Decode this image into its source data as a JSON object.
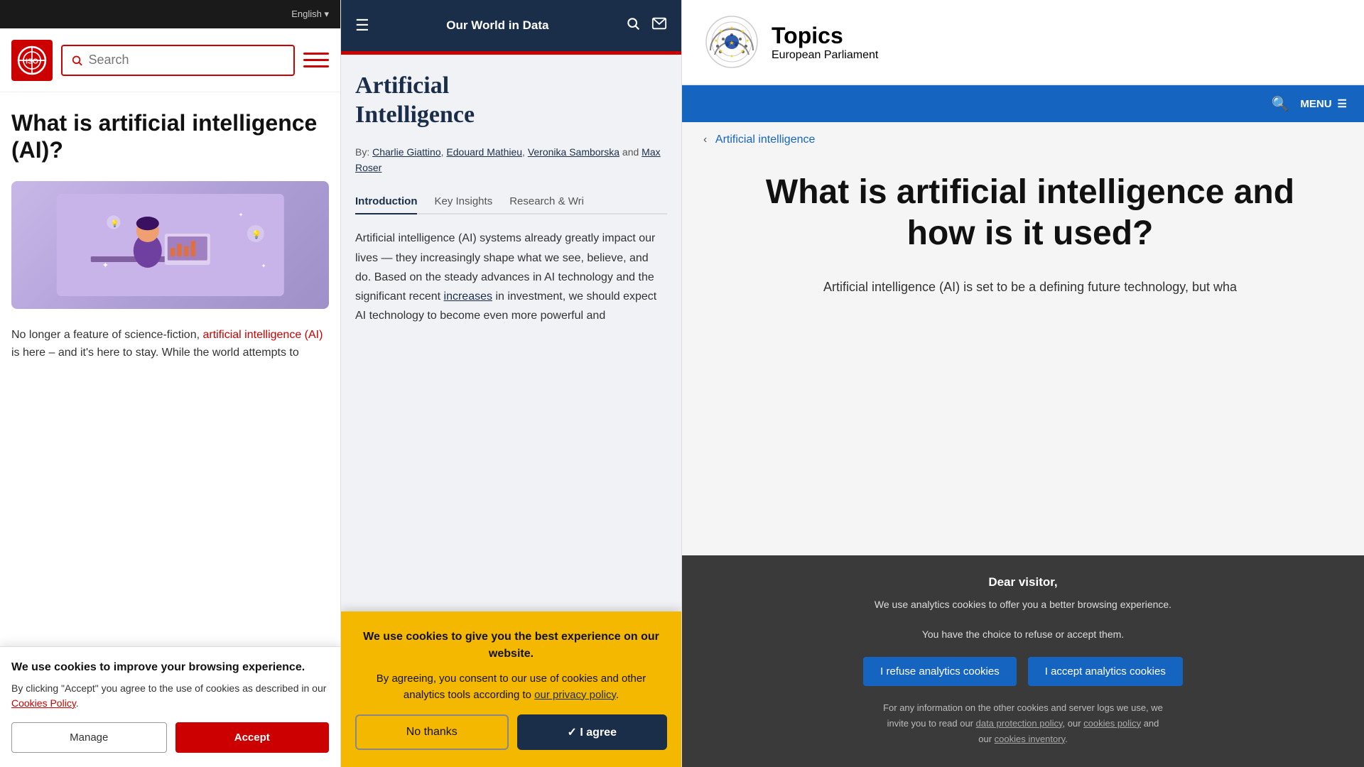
{
  "iso": {
    "topbar": {
      "language": "English ▾"
    },
    "logo": "ISO",
    "search_placeholder": "Search",
    "article_title": "What is artificial intelligence (AI)?",
    "body_text_start": "No longer a feature of science-fiction, ",
    "body_text_link": "artificial intelligence (AI)",
    "body_text_end": " is here – and it's here to stay. While the world attempts to",
    "cookie": {
      "title": "We use cookies to improve your browsing experience.",
      "description": "By clicking \"Accept\" you agree to the use of cookies as described in our ",
      "policy_link": "Cookies Policy",
      "policy_end": ".",
      "btn_manage": "Manage",
      "btn_accept": "Accept"
    }
  },
  "owid": {
    "header_title": "Our World\nin Data",
    "page_title": "Artificial\nIntelligence",
    "authors_prefix": "By: ",
    "authors": [
      {
        "name": "Charlie Giattino",
        "url": "#"
      },
      {
        "name": "Edouard Mathieu",
        "url": "#"
      },
      {
        "name": "Veronika Samborska",
        "url": "#"
      },
      {
        "name": "Max Roser",
        "url": "#"
      }
    ],
    "tabs": [
      {
        "label": "Introduction",
        "active": true
      },
      {
        "label": "Key Insights",
        "active": false
      },
      {
        "label": "Research & Wri",
        "active": false
      }
    ],
    "body_text": "Artificial intelligence (AI) systems already greatly impact our lives — they increasingly shape what we see, believe, and do. Based on the steady advances in AI technology and the significant recent ",
    "body_text_link": "increases",
    "body_text_end": " in investment, we should expect AI technology to become even more powerful and",
    "cookie": {
      "line1": "We use cookies to give you the best experience on our website.",
      "line2": "By agreeing, you consent to our use of cookies and other analytics tools according to ",
      "policy_link": "our privacy policy",
      "line3": ".",
      "btn_no": "No thanks",
      "btn_agree": "✓  I agree"
    }
  },
  "ep": {
    "logo_alt": "European Parliament Logo",
    "header_title": "Topics",
    "header_subtitle": "European Parliament",
    "nav_menu": "MENU",
    "breadcrumb": "Artificial intelligence",
    "article_title": "What is artificial intelligence and how is it used?",
    "body_text": "Artificial intelligence (AI) is set to be a defining future technology, but wha",
    "cookie": {
      "dear": "Dear visitor,",
      "desc1": "We use analytics cookies to offer you a better browsing experience.",
      "desc2": "You have the choice to refuse or accept them.",
      "btn_refuse": "I refuse analytics cookies",
      "btn_accept": "I accept analytics cookies",
      "footer1": "For any information on the other cookies and server logs we use, we",
      "footer2": "invite you to read our ",
      "footer_link1": "data protection policy",
      "footer3": ", our ",
      "footer_link2": "cookies policy",
      "footer4": " and",
      "footer5": "our ",
      "footer_link3": "cookies inventory",
      "footer6": "."
    }
  }
}
